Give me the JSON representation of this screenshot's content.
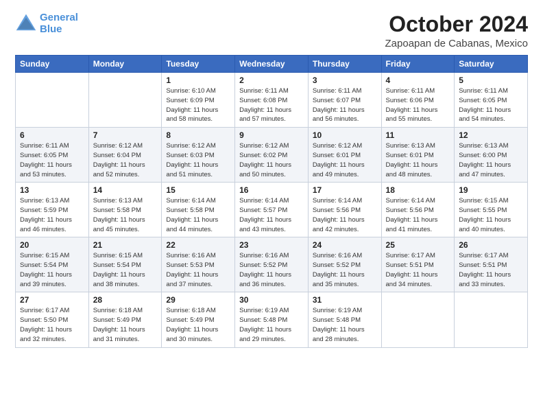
{
  "header": {
    "logo_line1": "General",
    "logo_line2": "Blue",
    "month": "October 2024",
    "location": "Zapoapan de Cabanas, Mexico"
  },
  "days_of_week": [
    "Sunday",
    "Monday",
    "Tuesday",
    "Wednesday",
    "Thursday",
    "Friday",
    "Saturday"
  ],
  "weeks": [
    [
      {
        "day": "",
        "info": ""
      },
      {
        "day": "",
        "info": ""
      },
      {
        "day": "1",
        "info": "Sunrise: 6:10 AM\nSunset: 6:09 PM\nDaylight: 11 hours and 58 minutes."
      },
      {
        "day": "2",
        "info": "Sunrise: 6:11 AM\nSunset: 6:08 PM\nDaylight: 11 hours and 57 minutes."
      },
      {
        "day": "3",
        "info": "Sunrise: 6:11 AM\nSunset: 6:07 PM\nDaylight: 11 hours and 56 minutes."
      },
      {
        "day": "4",
        "info": "Sunrise: 6:11 AM\nSunset: 6:06 PM\nDaylight: 11 hours and 55 minutes."
      },
      {
        "day": "5",
        "info": "Sunrise: 6:11 AM\nSunset: 6:05 PM\nDaylight: 11 hours and 54 minutes."
      }
    ],
    [
      {
        "day": "6",
        "info": "Sunrise: 6:11 AM\nSunset: 6:05 PM\nDaylight: 11 hours and 53 minutes."
      },
      {
        "day": "7",
        "info": "Sunrise: 6:12 AM\nSunset: 6:04 PM\nDaylight: 11 hours and 52 minutes."
      },
      {
        "day": "8",
        "info": "Sunrise: 6:12 AM\nSunset: 6:03 PM\nDaylight: 11 hours and 51 minutes."
      },
      {
        "day": "9",
        "info": "Sunrise: 6:12 AM\nSunset: 6:02 PM\nDaylight: 11 hours and 50 minutes."
      },
      {
        "day": "10",
        "info": "Sunrise: 6:12 AM\nSunset: 6:01 PM\nDaylight: 11 hours and 49 minutes."
      },
      {
        "day": "11",
        "info": "Sunrise: 6:13 AM\nSunset: 6:01 PM\nDaylight: 11 hours and 48 minutes."
      },
      {
        "day": "12",
        "info": "Sunrise: 6:13 AM\nSunset: 6:00 PM\nDaylight: 11 hours and 47 minutes."
      }
    ],
    [
      {
        "day": "13",
        "info": "Sunrise: 6:13 AM\nSunset: 5:59 PM\nDaylight: 11 hours and 46 minutes."
      },
      {
        "day": "14",
        "info": "Sunrise: 6:13 AM\nSunset: 5:58 PM\nDaylight: 11 hours and 45 minutes."
      },
      {
        "day": "15",
        "info": "Sunrise: 6:14 AM\nSunset: 5:58 PM\nDaylight: 11 hours and 44 minutes."
      },
      {
        "day": "16",
        "info": "Sunrise: 6:14 AM\nSunset: 5:57 PM\nDaylight: 11 hours and 43 minutes."
      },
      {
        "day": "17",
        "info": "Sunrise: 6:14 AM\nSunset: 5:56 PM\nDaylight: 11 hours and 42 minutes."
      },
      {
        "day": "18",
        "info": "Sunrise: 6:14 AM\nSunset: 5:56 PM\nDaylight: 11 hours and 41 minutes."
      },
      {
        "day": "19",
        "info": "Sunrise: 6:15 AM\nSunset: 5:55 PM\nDaylight: 11 hours and 40 minutes."
      }
    ],
    [
      {
        "day": "20",
        "info": "Sunrise: 6:15 AM\nSunset: 5:54 PM\nDaylight: 11 hours and 39 minutes."
      },
      {
        "day": "21",
        "info": "Sunrise: 6:15 AM\nSunset: 5:54 PM\nDaylight: 11 hours and 38 minutes."
      },
      {
        "day": "22",
        "info": "Sunrise: 6:16 AM\nSunset: 5:53 PM\nDaylight: 11 hours and 37 minutes."
      },
      {
        "day": "23",
        "info": "Sunrise: 6:16 AM\nSunset: 5:52 PM\nDaylight: 11 hours and 36 minutes."
      },
      {
        "day": "24",
        "info": "Sunrise: 6:16 AM\nSunset: 5:52 PM\nDaylight: 11 hours and 35 minutes."
      },
      {
        "day": "25",
        "info": "Sunrise: 6:17 AM\nSunset: 5:51 PM\nDaylight: 11 hours and 34 minutes."
      },
      {
        "day": "26",
        "info": "Sunrise: 6:17 AM\nSunset: 5:51 PM\nDaylight: 11 hours and 33 minutes."
      }
    ],
    [
      {
        "day": "27",
        "info": "Sunrise: 6:17 AM\nSunset: 5:50 PM\nDaylight: 11 hours and 32 minutes."
      },
      {
        "day": "28",
        "info": "Sunrise: 6:18 AM\nSunset: 5:49 PM\nDaylight: 11 hours and 31 minutes."
      },
      {
        "day": "29",
        "info": "Sunrise: 6:18 AM\nSunset: 5:49 PM\nDaylight: 11 hours and 30 minutes."
      },
      {
        "day": "30",
        "info": "Sunrise: 6:19 AM\nSunset: 5:48 PM\nDaylight: 11 hours and 29 minutes."
      },
      {
        "day": "31",
        "info": "Sunrise: 6:19 AM\nSunset: 5:48 PM\nDaylight: 11 hours and 28 minutes."
      },
      {
        "day": "",
        "info": ""
      },
      {
        "day": "",
        "info": ""
      }
    ]
  ]
}
